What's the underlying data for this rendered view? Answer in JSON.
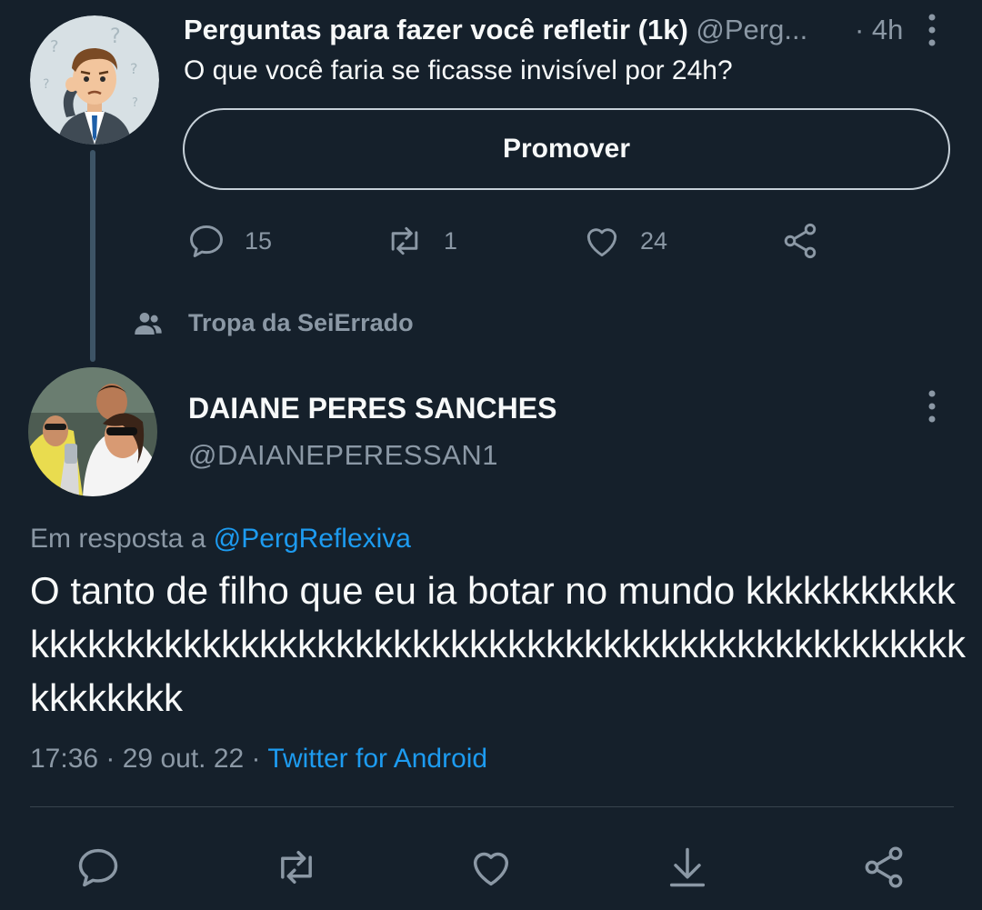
{
  "parent_tweet": {
    "author_name": "Perguntas para fazer você refletir (1k)",
    "author_handle": "@Perg...",
    "time": "· 4h",
    "text": "O que você faria se ficasse invisível por 24h?",
    "promote_label": "Promover",
    "reply_count": "15",
    "retweet_count": "1",
    "like_count": "24",
    "avatar_icon": "confused-man-avatar"
  },
  "community": {
    "name": "Tropa da SeiErrado",
    "icon": "people-icon"
  },
  "reply_tweet": {
    "author_name": "DAIANE PERES SANCHES",
    "author_handle": "@DAIANEPERESSAN1",
    "reply_prefix": "Em resposta a",
    "reply_to": "@PergReflexiva",
    "text": "O tanto de filho que eu ia botar no mundo kkkkkkkkkkkkkkkkkkkkkkkkkkkkkkkkkkkkkkkkkkkkkkkkkkkkkkkkkkkkkkkkkkkk",
    "time": "17:36",
    "date": "29 out. 22",
    "separator": " · ",
    "source": "Twitter for Android",
    "avatar_icon": "group-photo-avatar"
  },
  "colors": {
    "background": "#15202b",
    "text": "#f7f9f9",
    "muted": "#8b98a5",
    "link": "#1d9bf0",
    "thread_line": "#3d5466"
  }
}
